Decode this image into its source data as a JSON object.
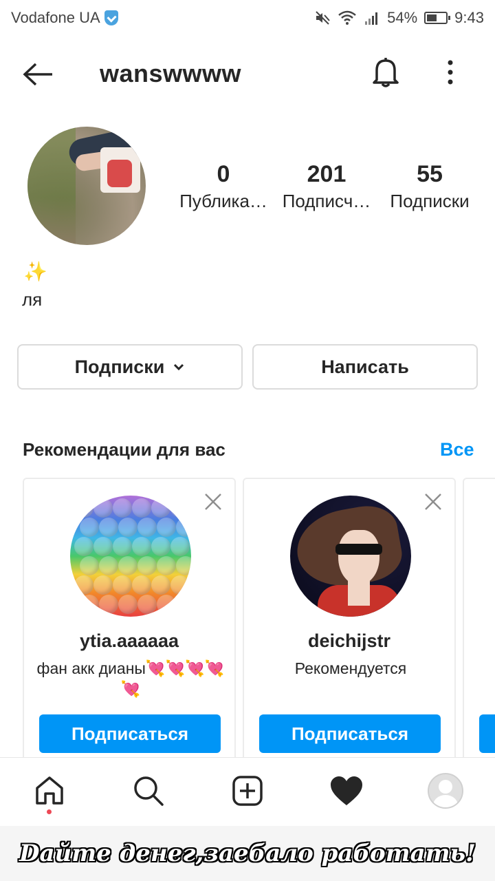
{
  "status_bar": {
    "carrier": "Vodafone UA",
    "battery": "54%",
    "battery_level": 0.54,
    "time": "9:43"
  },
  "header": {
    "username": "wanswwww",
    "icons": [
      "back-arrow-icon",
      "bell-icon",
      "more-vertical-icon"
    ]
  },
  "profile": {
    "stats": [
      {
        "value": "0",
        "label": "Публика…"
      },
      {
        "value": "201",
        "label": "Подписч…"
      },
      {
        "value": "55",
        "label": "Подписки"
      }
    ],
    "bio_emoji": "✨",
    "bio_text": "ля"
  },
  "actions": {
    "following_label": "Подписки",
    "message_label": "Написать"
  },
  "recommendations": {
    "title": "Рекомендации для вас",
    "see_all": "Все",
    "cards": [
      {
        "username": "ytia.aaaaaa",
        "subtitle": "фан акк дианы💘💘💘💘💘",
        "button": "Подписаться"
      },
      {
        "username": "deichijstr",
        "subtitle": "Рекомендуется",
        "button": "Подписаться"
      }
    ]
  },
  "bottom_nav": {
    "items": [
      "home-icon",
      "search-icon",
      "add-post-icon",
      "heart-icon",
      "profile-avatar"
    ],
    "active": "home-icon"
  },
  "caption": "Dайте денег,заебало работать!",
  "colors": {
    "accent": "#0095f6",
    "text": "#262626",
    "notification_dot": "#ed4956"
  }
}
